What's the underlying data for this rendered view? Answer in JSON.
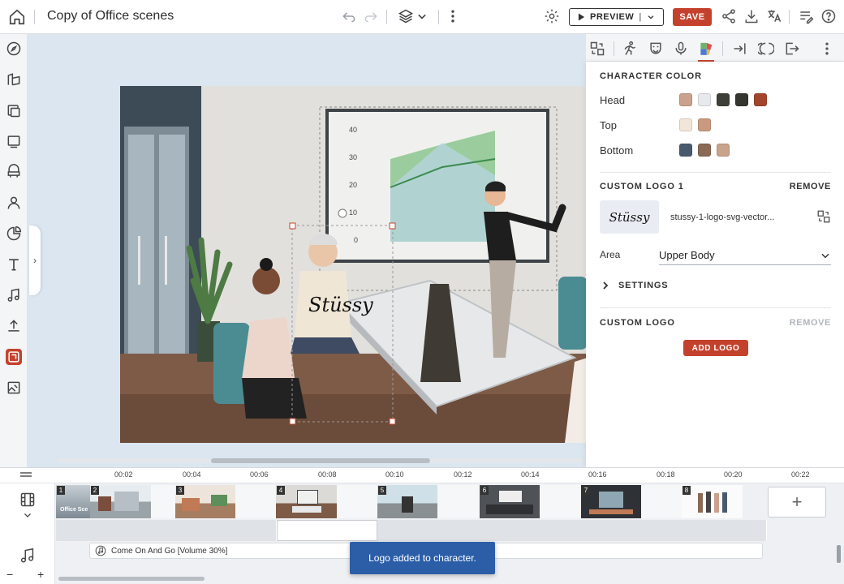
{
  "app": {
    "title": "Copy of Office scenes"
  },
  "toolbar": {
    "preview_label": "PREVIEW",
    "save_label": "SAVE"
  },
  "colors": {
    "accent": "#c4422d",
    "toast": "#2c5ea8"
  },
  "panel": {
    "character_color": {
      "title": "CHARACTER COLOR",
      "rows": [
        {
          "label": "Head",
          "swatches": [
            "#c9a18c",
            "#e8e9ec",
            "#3f3f3a",
            "#34362f",
            "#a2452c"
          ]
        },
        {
          "label": "Top",
          "swatches": [
            "#f1e6d8",
            "#c99a80"
          ]
        },
        {
          "label": "Bottom",
          "swatches": [
            "#4a5a6e",
            "#8a6a55",
            "#c9a28c"
          ]
        }
      ]
    },
    "custom_logo_1": {
      "title": "CUSTOM LOGO 1",
      "remove_label": "REMOVE",
      "filename": "stussy-1-logo-svg-vector...",
      "area_label": "Area",
      "area_value": "Upper Body",
      "settings_label": "SETTINGS"
    },
    "custom_logo_2": {
      "title": "CUSTOM LOGO",
      "remove_label": "REMOVE",
      "add_label": "ADD LOGO"
    }
  },
  "scene_chart": {
    "y_ticks": [
      "40",
      "30",
      "20",
      "10",
      "0"
    ]
  },
  "timeline": {
    "ruler_labels": [
      "00:02",
      "00:04",
      "00:06",
      "00:08",
      "00:10",
      "00:12",
      "00:14",
      "00:16",
      "00:18",
      "00:20",
      "00:22"
    ],
    "clips": [
      {
        "num": "1",
        "caption": "Office Sce"
      },
      {
        "num": "2",
        "caption": ""
      },
      {
        "num": "3",
        "caption": ""
      },
      {
        "num": "4",
        "caption": ""
      },
      {
        "num": "5",
        "caption": ""
      },
      {
        "num": "6",
        "caption": ""
      },
      {
        "num": "7",
        "caption": ""
      },
      {
        "num": "8",
        "caption": ""
      }
    ],
    "audio_label": "Come On And Go [Volume 30%]"
  },
  "toast": {
    "message": "Logo added to character."
  }
}
